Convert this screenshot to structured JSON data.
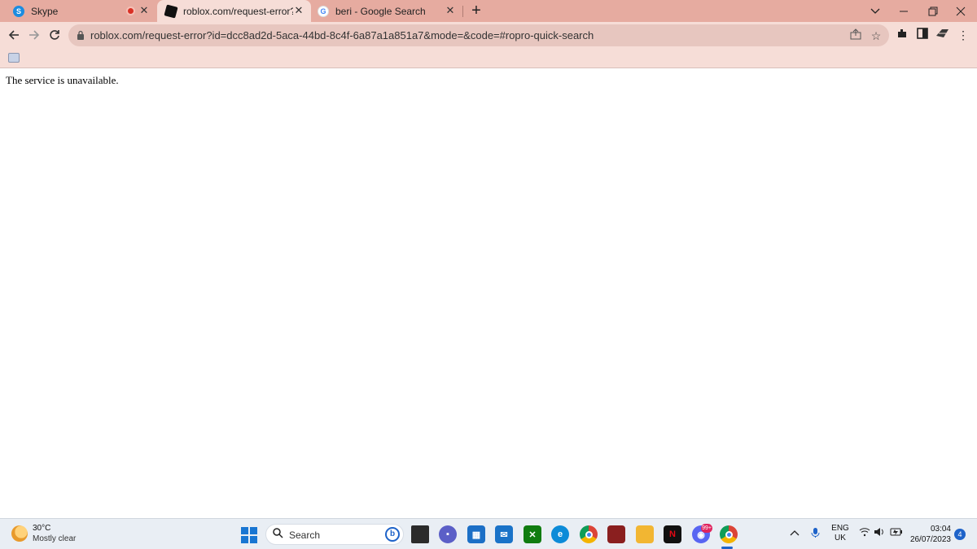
{
  "browser": {
    "tabs": [
      {
        "title": "Skype",
        "favicon": "skype-icon",
        "close": "✕"
      },
      {
        "title": "roblox.com/request-error?id=dcc",
        "favicon": "roblox-icon",
        "close": "✕"
      },
      {
        "title": "beri - Google Search",
        "favicon": "google-icon",
        "close": "✕"
      }
    ],
    "new_tab": "+",
    "url": "roblox.com/request-error?id=dcc8ad2d-5aca-44bd-8c4f-6a87a1a851a7&mode=&code=#ropro-quick-search"
  },
  "page": {
    "message": "The service is unavailable."
  },
  "taskbar": {
    "weather_temp": "30°C",
    "weather_desc": "Mostly clear",
    "search_placeholder": "Search",
    "lang_line1": "ENG",
    "lang_line2": "UK",
    "time": "03:04",
    "date": "26/07/2023",
    "notification_count": "4",
    "discord_badge": "99+"
  },
  "colors": {
    "tabstrip": "#e6aba0",
    "toolbar": "#f6ddd7",
    "omnibox": "#e7c6bf",
    "taskbar": "#e9eef4"
  }
}
